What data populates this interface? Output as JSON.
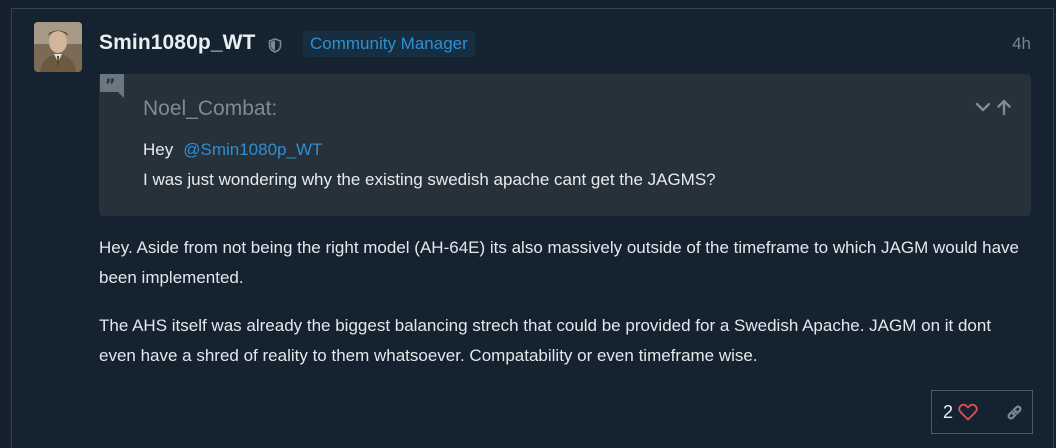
{
  "post": {
    "username": "Smin1080p_WT",
    "user_title": "Community Manager",
    "time": "4h",
    "quote": {
      "author": "Noel_Combat:",
      "greeting": "Hey",
      "mention": "@Smin1080p_WT",
      "text": "I was just wondering why the existing swedish apache cant get the JAGMS?"
    },
    "paragraphs": [
      "Hey. Aside from not being the right model (AH-64E) its also massively outside of the timeframe to which JAGM would have been implemented.",
      "The AHS itself was already the biggest balancing strech that could be provided for a Swedish Apache. JAGM on it dont even have a shred of reality to them whatsoever. Compatability or even timeframe wise."
    ],
    "like_count": "2"
  },
  "icons": {
    "moderator": "shield-icon",
    "quote": "quote-icon",
    "expand": "chevron-down-icon",
    "collapse": "arrow-up-icon",
    "like": "heart-icon",
    "share": "link-icon"
  },
  "colors": {
    "background": "#15212c",
    "post_border": "#2a465d",
    "accent": "#2e8fd3",
    "quote_background": "#27313a",
    "like": "#e04f5a"
  }
}
